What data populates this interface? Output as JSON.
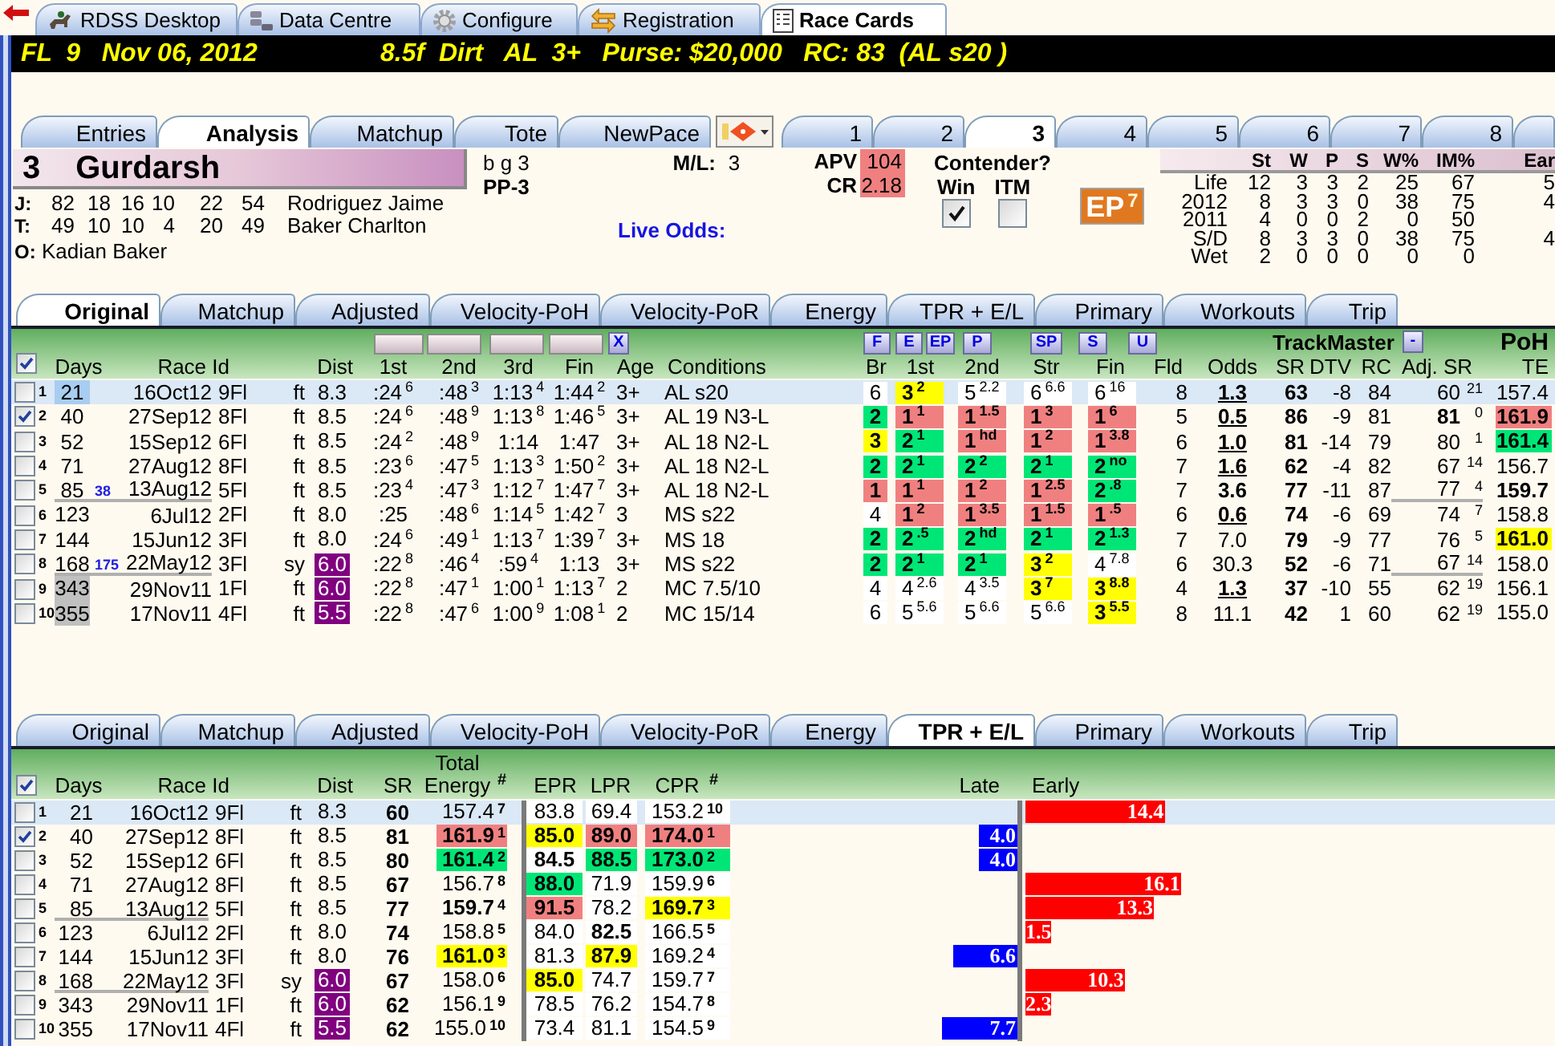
{
  "app_tabs": [
    {
      "label": "RDSS Desktop",
      "selected": false
    },
    {
      "label": "Data Centre",
      "selected": false
    },
    {
      "label": "Configure",
      "selected": false
    },
    {
      "label": "Registration",
      "selected": false
    },
    {
      "label": "Race Cards",
      "selected": true
    }
  ],
  "race_header": {
    "left": "FL  9   Nov 06, 2012",
    "right": "8.5f  Dirt   AL  3+   Purse: $20,000   RC: 83  (AL s20 )"
  },
  "view_tabs": [
    {
      "label": "Entries",
      "selected": false
    },
    {
      "label": "Analysis",
      "selected": true
    },
    {
      "label": "Matchup",
      "selected": false
    },
    {
      "label": "Tote",
      "selected": false
    },
    {
      "label": "NewPace",
      "selected": false
    }
  ],
  "horse_tabs": [
    {
      "label": "1",
      "selected": false
    },
    {
      "label": "2",
      "selected": false
    },
    {
      "label": "3",
      "selected": true
    },
    {
      "label": "4",
      "selected": false
    },
    {
      "label": "5",
      "selected": false
    },
    {
      "label": "6",
      "selected": false
    },
    {
      "label": "7",
      "selected": false
    },
    {
      "label": "8",
      "selected": false
    }
  ],
  "horse": {
    "number": "3",
    "name": "Gurdarsh",
    "description": "b g 3",
    "post": "PP-3",
    "ml_label": "M/L:",
    "ml": "3",
    "live_odds_label": "Live Odds:",
    "apv_label": "APV",
    "apv": "104",
    "cr_label": "CR",
    "cr": "2.18",
    "contender_label": "Contender?",
    "win_label": "Win",
    "win_checked": true,
    "itm_label": "ITM",
    "itm_checked": false,
    "ep": "EP$^{7}$"
  },
  "connections": [
    {
      "label": "J:",
      "stats": [
        "82",
        "18",
        "16",
        "10",
        "22",
        "54"
      ],
      "name": "Rodriguez Jaime"
    },
    {
      "label": "T:",
      "stats": [
        "49",
        "10",
        "10",
        "4",
        "20",
        "49"
      ],
      "name": "Baker Charlton"
    },
    {
      "label": "O:",
      "name": "Kadian Baker"
    }
  ],
  "record": {
    "columns": [
      "St",
      "W",
      "P",
      "S",
      "W%",
      "IM%",
      "Ear"
    ],
    "rows": [
      {
        "label": "Life",
        "values": [
          "12",
          "3",
          "3",
          "2",
          "25",
          "67",
          "5"
        ]
      },
      {
        "label": "2012",
        "values": [
          "8",
          "3",
          "3",
          "0",
          "38",
          "75",
          "4"
        ]
      },
      {
        "label": "2011",
        "values": [
          "4",
          "0",
          "0",
          "2",
          "0",
          "50"
        ]
      },
      {
        "label": "S/D",
        "values": [
          "8",
          "3",
          "3",
          "0",
          "38",
          "75",
          "4"
        ]
      },
      {
        "label": "Wet",
        "values": [
          "2",
          "0",
          "0",
          "0",
          "0",
          "0"
        ]
      }
    ]
  },
  "original_table": {
    "tabs": [
      {
        "label": "Original",
        "selected": true
      },
      {
        "label": "Matchup",
        "selected": false
      },
      {
        "label": "Adjusted",
        "selected": false
      },
      {
        "label": "Velocity-PoH",
        "selected": false
      },
      {
        "label": "Velocity-PoR",
        "selected": false
      },
      {
        "label": "Energy",
        "selected": false
      },
      {
        "label": "TPR + E/L",
        "selected": false
      },
      {
        "label": "Primary",
        "selected": false
      },
      {
        "label": "Workouts",
        "selected": false
      },
      {
        "label": "Trip",
        "selected": false
      }
    ],
    "all_checked": true,
    "x_button": "X",
    "pace_buttons": [
      "F",
      "E",
      "EP",
      "P",
      "SP",
      "S",
      "U"
    ],
    "trackmaster_label": "TrackMaster",
    "minus_button": "-",
    "poh_label": "PoH",
    "columns": [
      "Days",
      "Race Id",
      "Dist",
      "1st",
      "2nd",
      "3rd",
      "Fin",
      "Age",
      "Conditions",
      "Br",
      "1st",
      "2nd",
      "Str",
      "Fin",
      "Fld",
      "Odds",
      "SR",
      "DTV",
      "RC",
      "Adj. SR",
      "TE"
    ],
    "rows": [
      {
        "num": "1",
        "checked": false,
        "selected": true,
        "separator": false,
        "days": {
          "text": "21",
          "color": "#a8cdf0"
        },
        "date": "16Oct12",
        "race": "9Fl",
        "surface": "ft",
        "dist": "8.3",
        "first_call": ":24$^{6}$",
        "second_call": ":48$^{3}$",
        "third_call": "1:13$^{4}$",
        "final_time": "1:44$^{2}$",
        "age": "3+",
        "conditions": "AL s20",
        "break_pos": {
          "text": "6"
        },
        "first_pos": {
          "text": "3$^{2}$",
          "color": "#ffff00",
          "bold": true
        },
        "second_pos": {
          "text": "5$^{2.2}$"
        },
        "stretch_pos": {
          "text": "6$^{6.6}$"
        },
        "finish_pos": {
          "text": "6$^{16}$"
        },
        "field": "8",
        "odds": {
          "text": "1.3",
          "bold": true,
          "underlined": true
        },
        "sr": "63",
        "dtv": "-8",
        "rc": "84",
        "adj_sr": {
          "text": "60"
        },
        "adj_rank": "21",
        "te": {
          "text": "157.4"
        }
      },
      {
        "num": "2",
        "checked": true,
        "selected": false,
        "separator": false,
        "days": "40",
        "date": "27Sep12",
        "race": "8Fl",
        "surface": "ft",
        "dist": "8.5",
        "first_call": ":24$^{6}$",
        "second_call": ":48$^{9}$",
        "third_call": "1:13$^{8}$",
        "final_time": "1:46$^{5}$",
        "age": "3+",
        "conditions": "AL 19 N3-L",
        "break_pos": {
          "text": "2",
          "color": "#00e676",
          "bold": true
        },
        "first_pos": {
          "text": "1$^{1}$",
          "color": "#f08080",
          "bold": true
        },
        "second_pos": {
          "text": "1$^{1.5}$",
          "color": "#f08080",
          "bold": true
        },
        "stretch_pos": {
          "text": "1$^{3}$",
          "color": "#f08080",
          "bold": true
        },
        "finish_pos": {
          "text": "1$^{6}$",
          "color": "#f08080",
          "bold": true
        },
        "field": "5",
        "odds": {
          "text": "0.5",
          "bold": true,
          "underlined": true
        },
        "sr": "86",
        "dtv": "-9",
        "rc": "81",
        "adj_sr": {
          "text": "81",
          "bold": true
        },
        "adj_rank": "0",
        "te": {
          "text": "161.9",
          "color": "#f08080",
          "bold": true
        }
      },
      {
        "num": "3",
        "checked": false,
        "selected": false,
        "separator": false,
        "days": "52",
        "date": "15Sep12",
        "race": "6Fl",
        "surface": "ft",
        "dist": "8.5",
        "first_call": ":24$^{2}$",
        "second_call": ":48$^{9}$",
        "third_call": "1:14",
        "final_time": "1:47",
        "age": "3+",
        "conditions": "AL 18 N2-L",
        "break_pos": {
          "text": "3",
          "color": "#ffff00",
          "bold": true
        },
        "first_pos": {
          "text": "2$^{1}$",
          "color": "#00e676",
          "bold": true
        },
        "second_pos": {
          "text": "1$^{hd}$",
          "color": "#f08080",
          "bold": true
        },
        "stretch_pos": {
          "text": "1$^{2}$",
          "color": "#f08080",
          "bold": true
        },
        "finish_pos": {
          "text": "1$^{3.8}$",
          "color": "#f08080",
          "bold": true
        },
        "field": "6",
        "odds": {
          "text": "1.0",
          "bold": true,
          "underlined": true
        },
        "sr": "81",
        "dtv": "-14",
        "rc": "79",
        "adj_sr": {
          "text": "80"
        },
        "adj_rank": "1",
        "te": {
          "text": "161.4",
          "color": "#00e676",
          "bold": true
        }
      },
      {
        "num": "4",
        "checked": false,
        "selected": false,
        "separator": false,
        "days": "71",
        "date": "27Aug12",
        "race": "8Fl",
        "surface": "ft",
        "dist": "8.5",
        "first_call": ":23$^{6}$",
        "second_call": ":47$^{5}$",
        "third_call": "1:13$^{3}$",
        "final_time": "1:50$^{2}$",
        "age": "3+",
        "conditions": "AL 18 N2-L",
        "break_pos": {
          "text": "2",
          "color": "#00e676",
          "bold": true
        },
        "first_pos": {
          "text": "2$^{1}$",
          "color": "#00e676",
          "bold": true
        },
        "second_pos": {
          "text": "2$^{2}$",
          "color": "#00e676",
          "bold": true
        },
        "stretch_pos": {
          "text": "2$^{1}$",
          "color": "#00e676",
          "bold": true
        },
        "finish_pos": {
          "text": "2$^{no}$",
          "color": "#00e676",
          "bold": true
        },
        "field": "7",
        "odds": {
          "text": "1.6",
          "bold": true,
          "underlined": true
        },
        "sr": "62",
        "dtv": "-4",
        "rc": "82",
        "adj_sr": {
          "text": "67"
        },
        "adj_rank": "14",
        "te": {
          "text": "156.7"
        }
      },
      {
        "num": "5",
        "checked": false,
        "selected": false,
        "separator": true,
        "days": "85",
        "gap": "38",
        "date": "13Aug12",
        "race": "5Fl",
        "surface": "ft",
        "dist": "8.5",
        "first_call": ":23$^{4}$",
        "second_call": ":47$^{3}$",
        "third_call": "1:12$^{7}$",
        "final_time": "1:47$^{7}$",
        "age": "3+",
        "conditions": "AL 18 N2-L",
        "break_pos": {
          "text": "1",
          "color": "#f08080",
          "bold": true
        },
        "first_pos": {
          "text": "1$^{1}$",
          "color": "#f08080",
          "bold": true
        },
        "second_pos": {
          "text": "1$^{2}$",
          "color": "#f08080",
          "bold": true
        },
        "stretch_pos": {
          "text": "1$^{2.5}$",
          "color": "#f08080",
          "bold": true
        },
        "finish_pos": {
          "text": "2$^{.8}$",
          "color": "#00e676",
          "bold": true
        },
        "field": "7",
        "odds": {
          "text": "3.6",
          "bold": true,
          "underlined": false
        },
        "sr": "77",
        "dtv": "-11",
        "rc": "87",
        "adj_sr": {
          "text": "77"
        },
        "adj_rank": "4",
        "te": {
          "text": "159.7",
          "bold": true
        }
      },
      {
        "num": "6",
        "checked": false,
        "selected": false,
        "separator": false,
        "days": "123",
        "date": "6Jul12",
        "race": "2Fl",
        "surface": "ft",
        "dist": "8.0",
        "first_call": ":25",
        "second_call": ":48$^{6}$",
        "third_call": "1:14$^{5}$",
        "final_time": "1:42$^{7}$",
        "age": "3",
        "conditions": "MS s22",
        "break_pos": {
          "text": "4"
        },
        "first_pos": {
          "text": "1$^{2}$",
          "color": "#f08080",
          "bold": true
        },
        "second_pos": {
          "text": "1$^{3.5}$",
          "color": "#f08080",
          "bold": true
        },
        "stretch_pos": {
          "text": "1$^{1.5}$",
          "color": "#f08080",
          "bold": true
        },
        "finish_pos": {
          "text": "1$^{.5}$",
          "color": "#f08080",
          "bold": true
        },
        "field": "6",
        "odds": {
          "text": "0.6",
          "bold": true,
          "underlined": true
        },
        "sr": "74",
        "dtv": "-6",
        "rc": "69",
        "adj_sr": {
          "text": "74"
        },
        "adj_rank": "7",
        "te": {
          "text": "158.8"
        }
      },
      {
        "num": "7",
        "checked": false,
        "selected": false,
        "separator": false,
        "days": "144",
        "date": "15Jun12",
        "race": "3Fl",
        "surface": "ft",
        "dist": "8.0",
        "first_call": ":24$^{6}$",
        "second_call": ":49$^{1}$",
        "third_call": "1:13$^{7}$",
        "final_time": "1:39$^{7}$",
        "age": "3+",
        "conditions": "MS 18",
        "break_pos": {
          "text": "2",
          "color": "#00e676",
          "bold": true
        },
        "first_pos": {
          "text": "2$^{.5}$",
          "color": "#00e676",
          "bold": true
        },
        "second_pos": {
          "text": "2$^{hd}$",
          "color": "#00e676",
          "bold": true
        },
        "stretch_pos": {
          "text": "2$^{1}$",
          "color": "#00e676",
          "bold": true
        },
        "finish_pos": {
          "text": "2$^{1.3}$",
          "color": "#00e676",
          "bold": true
        },
        "field": "7",
        "odds": {
          "text": "7.0",
          "bold": false,
          "underlined": false
        },
        "sr": "79",
        "dtv": "-9",
        "rc": "77",
        "adj_sr": {
          "text": "76"
        },
        "adj_rank": "5",
        "te": {
          "text": "161.0",
          "color": "#ffff00",
          "bold": true
        }
      },
      {
        "num": "8",
        "checked": false,
        "selected": false,
        "separator": true,
        "days": "168",
        "gap": "175",
        "date": "22May12",
        "race": "3Fl",
        "surface": "sy",
        "dist": {
          "text": "6.0",
          "color": "#800080"
        },
        "first_call": ":22$^{8}$",
        "second_call": ":46$^{4}$",
        "third_call": ":59$^{4}$",
        "final_time": "1:13",
        "age": "3+",
        "conditions": "MS s22",
        "break_pos": {
          "text": "2",
          "color": "#00e676",
          "bold": true
        },
        "first_pos": {
          "text": "2$^{1}$",
          "color": "#00e676",
          "bold": true
        },
        "second_pos": {
          "text": "2$^{1}$",
          "color": "#00e676",
          "bold": true
        },
        "stretch_pos": {
          "text": "3$^{2}$",
          "color": "#ffff00",
          "bold": true
        },
        "finish_pos": {
          "text": "4$^{7.8}$"
        },
        "field": "6",
        "odds": {
          "text": "30.3",
          "bold": false,
          "underlined": false
        },
        "sr": "52",
        "dtv": "-6",
        "rc": "71",
        "adj_sr": {
          "text": "67"
        },
        "adj_rank": "14",
        "te": {
          "text": "158.0"
        }
      },
      {
        "num": "9",
        "checked": false,
        "selected": false,
        "separator": false,
        "days": {
          "text": "343",
          "color": "#c0c0c0"
        },
        "date": "29Nov11",
        "race": "1Fl",
        "surface": "ft",
        "dist": {
          "text": "6.0",
          "color": "#800080"
        },
        "first_call": ":22$^{8}$",
        "second_call": ":47$^{1}$",
        "third_call": "1:00$^{1}$",
        "final_time": "1:13$^{7}$",
        "age": "2",
        "conditions": "MC 7.5/10",
        "break_pos": {
          "text": "4"
        },
        "first_pos": {
          "text": "4$^{2.6}$"
        },
        "second_pos": {
          "text": "4$^{3.5}$"
        },
        "stretch_pos": {
          "text": "3$^{7}$",
          "color": "#ffff00",
          "bold": true
        },
        "finish_pos": {
          "text": "3$^{8.8}$",
          "color": "#ffff00",
          "bold": true
        },
        "field": "4",
        "odds": {
          "text": "1.3",
          "bold": true,
          "underlined": true
        },
        "sr": "37",
        "dtv": "-10",
        "rc": "55",
        "adj_sr": {
          "text": "62"
        },
        "adj_rank": "19",
        "te": {
          "text": "156.1"
        }
      },
      {
        "num": "10",
        "checked": false,
        "selected": false,
        "separator": false,
        "days": {
          "text": "355",
          "color": "#c0c0c0"
        },
        "date": "17Nov11",
        "race": "4Fl",
        "surface": "ft",
        "dist": {
          "text": "5.5",
          "color": "#800080"
        },
        "first_call": ":22$^{8}$",
        "second_call": ":47$^{6}$",
        "third_call": "1:00$^{9}$",
        "final_time": "1:08$^{1}$",
        "age": "2",
        "conditions": "MC 15/14",
        "break_pos": {
          "text": "6"
        },
        "first_pos": {
          "text": "5$^{5.6}$"
        },
        "second_pos": {
          "text": "5$^{6.6}$"
        },
        "stretch_pos": {
          "text": "5$^{6.6}$"
        },
        "finish_pos": {
          "text": "3$^{5.5}$",
          "color": "#ffff00",
          "bold": true
        },
        "field": "8",
        "odds": {
          "text": "11.1",
          "bold": false,
          "underlined": false
        },
        "sr": "42",
        "dtv": "1",
        "rc": "60",
        "adj_sr": {
          "text": "62"
        },
        "adj_rank": "19",
        "te": {
          "text": "155.0"
        }
      }
    ]
  },
  "energy_table": {
    "tabs": [
      {
        "label": "Original",
        "selected": false
      },
      {
        "label": "Matchup",
        "selected": false
      },
      {
        "label": "Adjusted",
        "selected": false
      },
      {
        "label": "Velocity-PoH",
        "selected": false
      },
      {
        "label": "Velocity-PoR",
        "selected": false
      },
      {
        "label": "Energy",
        "selected": false
      },
      {
        "label": "TPR + E/L",
        "selected": true
      },
      {
        "label": "Primary",
        "selected": false
      },
      {
        "label": "Workouts",
        "selected": false
      },
      {
        "label": "Trip",
        "selected": false
      }
    ],
    "all_checked": true,
    "columns": [
      "Days",
      "Race Id",
      "Dist",
      "SR",
      "Total Energy",
      "#",
      "EPR",
      "LPR",
      "CPR",
      "#",
      "Late",
      "Early"
    ],
    "rows": [
      {
        "num": "1",
        "checked": false,
        "selected": true,
        "separator": false,
        "days": "21",
        "date": "16Oct12",
        "race": "9Fl",
        "surface": "ft",
        "dist": "8.3",
        "sr": "60",
        "energy": {
          "text": "157.4",
          "rank": "7"
        },
        "epr": {
          "text": "83.8"
        },
        "lpr": {
          "text": "69.4"
        },
        "cpr": {
          "text": "153.2",
          "rank": "10"
        },
        "trend": {
          "kind": "early",
          "value": "14.4"
        }
      },
      {
        "num": "2",
        "checked": true,
        "selected": false,
        "separator": false,
        "days": "40",
        "date": "27Sep12",
        "race": "8Fl",
        "surface": "ft",
        "dist": "8.5",
        "sr": "81",
        "energy": {
          "text": "161.9",
          "rank": "1",
          "color": "#f08080",
          "bold": true
        },
        "epr": {
          "text": "85.0",
          "color": "#ffff00",
          "bold": true
        },
        "lpr": {
          "text": "89.0",
          "color": "#f08080",
          "bold": true
        },
        "cpr": {
          "text": "174.0",
          "rank": "1",
          "color": "#f08080",
          "bold": true
        },
        "trend": {
          "kind": "late",
          "value": "4.0"
        }
      },
      {
        "num": "3",
        "checked": false,
        "selected": false,
        "separator": false,
        "days": "52",
        "date": "15Sep12",
        "race": "6Fl",
        "surface": "ft",
        "dist": "8.5",
        "sr": "80",
        "energy": {
          "text": "161.4",
          "rank": "2",
          "color": "#00e676",
          "bold": true
        },
        "epr": {
          "text": "84.5",
          "bold": true
        },
        "lpr": {
          "text": "88.5",
          "color": "#00e676",
          "bold": true
        },
        "cpr": {
          "text": "173.0",
          "rank": "2",
          "color": "#00e676",
          "bold": true
        },
        "trend": {
          "kind": "late",
          "value": "4.0"
        }
      },
      {
        "num": "4",
        "checked": false,
        "selected": false,
        "separator": false,
        "days": "71",
        "date": "27Aug12",
        "race": "8Fl",
        "surface": "ft",
        "dist": "8.5",
        "sr": "67",
        "energy": {
          "text": "156.7",
          "rank": "8"
        },
        "epr": {
          "text": "88.0",
          "color": "#00e676",
          "bold": true
        },
        "lpr": {
          "text": "71.9"
        },
        "cpr": {
          "text": "159.9",
          "rank": "6"
        },
        "trend": {
          "kind": "early",
          "value": "16.1"
        }
      },
      {
        "num": "5",
        "checked": false,
        "selected": false,
        "separator": true,
        "days": "85",
        "date": "13Aug12",
        "race": "5Fl",
        "surface": "ft",
        "dist": "8.5",
        "sr": "77",
        "energy": {
          "text": "159.7",
          "rank": "4",
          "bold": true
        },
        "epr": {
          "text": "91.5",
          "color": "#f08080",
          "bold": true
        },
        "lpr": {
          "text": "78.2"
        },
        "cpr": {
          "text": "169.7",
          "rank": "3",
          "color": "#ffff00",
          "bold": true
        },
        "trend": {
          "kind": "early",
          "value": "13.3"
        }
      },
      {
        "num": "6",
        "checked": false,
        "selected": false,
        "separator": false,
        "days": "123",
        "date": "6Jul12",
        "race": "2Fl",
        "surface": "ft",
        "dist": "8.0",
        "sr": "74",
        "energy": {
          "text": "158.8",
          "rank": "5"
        },
        "epr": {
          "text": "84.0"
        },
        "lpr": {
          "text": "82.5",
          "bold": true
        },
        "cpr": {
          "text": "166.5",
          "rank": "5"
        },
        "trend": {
          "kind": "early",
          "value": "1.5"
        }
      },
      {
        "num": "7",
        "checked": false,
        "selected": false,
        "separator": false,
        "days": "144",
        "date": "15Jun12",
        "race": "3Fl",
        "surface": "ft",
        "dist": "8.0",
        "sr": "76",
        "energy": {
          "text": "161.0",
          "rank": "3",
          "color": "#ffff00",
          "bold": true
        },
        "epr": {
          "text": "81.3"
        },
        "lpr": {
          "text": "87.9",
          "color": "#ffff00",
          "bold": true
        },
        "cpr": {
          "text": "169.2",
          "rank": "4"
        },
        "trend": {
          "kind": "late",
          "value": "6.6"
        }
      },
      {
        "num": "8",
        "checked": false,
        "selected": false,
        "separator": true,
        "days": "168",
        "date": "22May12",
        "race": "3Fl",
        "surface": "sy",
        "dist": {
          "text": "6.0",
          "color": "#800080"
        },
        "sr": "67",
        "energy": {
          "text": "158.0",
          "rank": "6"
        },
        "epr": {
          "text": "85.0",
          "color": "#ffff00",
          "bold": true
        },
        "lpr": {
          "text": "74.7"
        },
        "cpr": {
          "text": "159.7",
          "rank": "7"
        },
        "trend": {
          "kind": "early",
          "value": "10.3"
        }
      },
      {
        "num": "9",
        "checked": false,
        "selected": false,
        "separator": false,
        "days": "343",
        "date": "29Nov11",
        "race": "1Fl",
        "surface": "ft",
        "dist": {
          "text": "6.0",
          "color": "#800080"
        },
        "sr": "62",
        "energy": {
          "text": "156.1",
          "rank": "9"
        },
        "epr": {
          "text": "78.5"
        },
        "lpr": {
          "text": "76.2"
        },
        "cpr": {
          "text": "154.7",
          "rank": "8"
        },
        "trend": {
          "kind": "early",
          "value": "2.3"
        }
      },
      {
        "num": "10",
        "checked": false,
        "selected": false,
        "separator": false,
        "days": "355",
        "date": "17Nov11",
        "race": "4Fl",
        "surface": "ft",
        "dist": {
          "text": "5.5",
          "color": "#800080"
        },
        "sr": "62",
        "energy": {
          "text": "155.0",
          "rank": "10"
        },
        "epr": {
          "text": "73.4"
        },
        "lpr": {
          "text": "81.1"
        },
        "cpr": {
          "text": "154.5",
          "rank": "9"
        },
        "trend": {
          "kind": "late",
          "value": "7.7"
        }
      }
    ]
  }
}
